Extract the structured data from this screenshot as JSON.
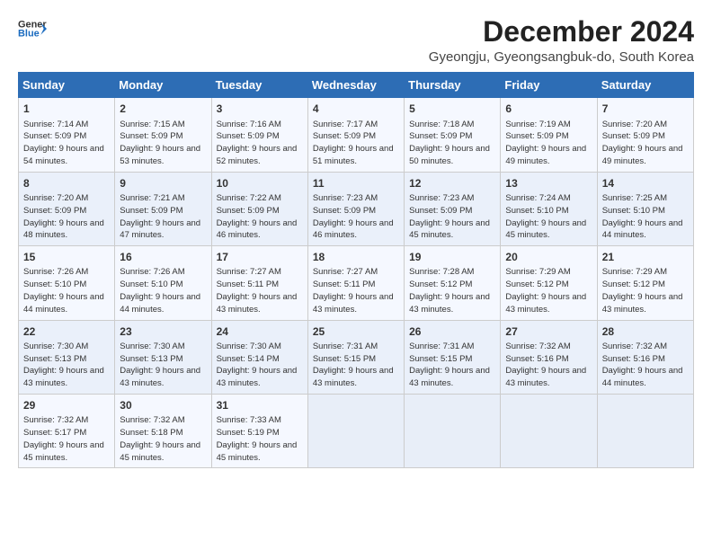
{
  "header": {
    "logo_line1": "General",
    "logo_line2": "Blue",
    "title": "December 2024",
    "subtitle": "Gyeongju, Gyeongsangbuk-do, South Korea"
  },
  "calendar": {
    "days_of_week": [
      "Sunday",
      "Monday",
      "Tuesday",
      "Wednesday",
      "Thursday",
      "Friday",
      "Saturday"
    ],
    "weeks": [
      [
        {
          "day": "",
          "empty": true
        },
        {
          "day": "",
          "empty": true
        },
        {
          "day": "",
          "empty": true
        },
        {
          "day": "",
          "empty": true
        },
        {
          "day": "5",
          "sunrise": "Sunrise: 7:18 AM",
          "sunset": "Sunset: 5:09 PM",
          "daylight": "Daylight: 9 hours and 50 minutes."
        },
        {
          "day": "6",
          "sunrise": "Sunrise: 7:19 AM",
          "sunset": "Sunset: 5:09 PM",
          "daylight": "Daylight: 9 hours and 49 minutes."
        },
        {
          "day": "7",
          "sunrise": "Sunrise: 7:20 AM",
          "sunset": "Sunset: 5:09 PM",
          "daylight": "Daylight: 9 hours and 49 minutes."
        }
      ],
      [
        {
          "day": "1",
          "sunrise": "Sunrise: 7:14 AM",
          "sunset": "Sunset: 5:09 PM",
          "daylight": "Daylight: 9 hours and 54 minutes."
        },
        {
          "day": "2",
          "sunrise": "Sunrise: 7:15 AM",
          "sunset": "Sunset: 5:09 PM",
          "daylight": "Daylight: 9 hours and 53 minutes."
        },
        {
          "day": "3",
          "sunrise": "Sunrise: 7:16 AM",
          "sunset": "Sunset: 5:09 PM",
          "daylight": "Daylight: 9 hours and 52 minutes."
        },
        {
          "day": "4",
          "sunrise": "Sunrise: 7:17 AM",
          "sunset": "Sunset: 5:09 PM",
          "daylight": "Daylight: 9 hours and 51 minutes."
        },
        {
          "day": "5",
          "sunrise": "Sunrise: 7:18 AM",
          "sunset": "Sunset: 5:09 PM",
          "daylight": "Daylight: 9 hours and 50 minutes."
        },
        {
          "day": "6",
          "sunrise": "Sunrise: 7:19 AM",
          "sunset": "Sunset: 5:09 PM",
          "daylight": "Daylight: 9 hours and 49 minutes."
        },
        {
          "day": "7",
          "sunrise": "Sunrise: 7:20 AM",
          "sunset": "Sunset: 5:09 PM",
          "daylight": "Daylight: 9 hours and 49 minutes."
        }
      ],
      [
        {
          "day": "8",
          "sunrise": "Sunrise: 7:20 AM",
          "sunset": "Sunset: 5:09 PM",
          "daylight": "Daylight: 9 hours and 48 minutes."
        },
        {
          "day": "9",
          "sunrise": "Sunrise: 7:21 AM",
          "sunset": "Sunset: 5:09 PM",
          "daylight": "Daylight: 9 hours and 47 minutes."
        },
        {
          "day": "10",
          "sunrise": "Sunrise: 7:22 AM",
          "sunset": "Sunset: 5:09 PM",
          "daylight": "Daylight: 9 hours and 46 minutes."
        },
        {
          "day": "11",
          "sunrise": "Sunrise: 7:23 AM",
          "sunset": "Sunset: 5:09 PM",
          "daylight": "Daylight: 9 hours and 46 minutes."
        },
        {
          "day": "12",
          "sunrise": "Sunrise: 7:23 AM",
          "sunset": "Sunset: 5:09 PM",
          "daylight": "Daylight: 9 hours and 45 minutes."
        },
        {
          "day": "13",
          "sunrise": "Sunrise: 7:24 AM",
          "sunset": "Sunset: 5:10 PM",
          "daylight": "Daylight: 9 hours and 45 minutes."
        },
        {
          "day": "14",
          "sunrise": "Sunrise: 7:25 AM",
          "sunset": "Sunset: 5:10 PM",
          "daylight": "Daylight: 9 hours and 44 minutes."
        }
      ],
      [
        {
          "day": "15",
          "sunrise": "Sunrise: 7:26 AM",
          "sunset": "Sunset: 5:10 PM",
          "daylight": "Daylight: 9 hours and 44 minutes."
        },
        {
          "day": "16",
          "sunrise": "Sunrise: 7:26 AM",
          "sunset": "Sunset: 5:10 PM",
          "daylight": "Daylight: 9 hours and 44 minutes."
        },
        {
          "day": "17",
          "sunrise": "Sunrise: 7:27 AM",
          "sunset": "Sunset: 5:11 PM",
          "daylight": "Daylight: 9 hours and 43 minutes."
        },
        {
          "day": "18",
          "sunrise": "Sunrise: 7:27 AM",
          "sunset": "Sunset: 5:11 PM",
          "daylight": "Daylight: 9 hours and 43 minutes."
        },
        {
          "day": "19",
          "sunrise": "Sunrise: 7:28 AM",
          "sunset": "Sunset: 5:12 PM",
          "daylight": "Daylight: 9 hours and 43 minutes."
        },
        {
          "day": "20",
          "sunrise": "Sunrise: 7:29 AM",
          "sunset": "Sunset: 5:12 PM",
          "daylight": "Daylight: 9 hours and 43 minutes."
        },
        {
          "day": "21",
          "sunrise": "Sunrise: 7:29 AM",
          "sunset": "Sunset: 5:12 PM",
          "daylight": "Daylight: 9 hours and 43 minutes."
        }
      ],
      [
        {
          "day": "22",
          "sunrise": "Sunrise: 7:30 AM",
          "sunset": "Sunset: 5:13 PM",
          "daylight": "Daylight: 9 hours and 43 minutes."
        },
        {
          "day": "23",
          "sunrise": "Sunrise: 7:30 AM",
          "sunset": "Sunset: 5:13 PM",
          "daylight": "Daylight: 9 hours and 43 minutes."
        },
        {
          "day": "24",
          "sunrise": "Sunrise: 7:30 AM",
          "sunset": "Sunset: 5:14 PM",
          "daylight": "Daylight: 9 hours and 43 minutes."
        },
        {
          "day": "25",
          "sunrise": "Sunrise: 7:31 AM",
          "sunset": "Sunset: 5:15 PM",
          "daylight": "Daylight: 9 hours and 43 minutes."
        },
        {
          "day": "26",
          "sunrise": "Sunrise: 7:31 AM",
          "sunset": "Sunset: 5:15 PM",
          "daylight": "Daylight: 9 hours and 43 minutes."
        },
        {
          "day": "27",
          "sunrise": "Sunrise: 7:32 AM",
          "sunset": "Sunset: 5:16 PM",
          "daylight": "Daylight: 9 hours and 43 minutes."
        },
        {
          "day": "28",
          "sunrise": "Sunrise: 7:32 AM",
          "sunset": "Sunset: 5:16 PM",
          "daylight": "Daylight: 9 hours and 44 minutes."
        }
      ],
      [
        {
          "day": "29",
          "sunrise": "Sunrise: 7:32 AM",
          "sunset": "Sunset: 5:17 PM",
          "daylight": "Daylight: 9 hours and 45 minutes."
        },
        {
          "day": "30",
          "sunrise": "Sunrise: 7:32 AM",
          "sunset": "Sunset: 5:18 PM",
          "daylight": "Daylight: 9 hours and 45 minutes."
        },
        {
          "day": "31",
          "sunrise": "Sunrise: 7:33 AM",
          "sunset": "Sunset: 5:19 PM",
          "daylight": "Daylight: 9 hours and 45 minutes."
        },
        {
          "day": "",
          "empty": true
        },
        {
          "day": "",
          "empty": true
        },
        {
          "day": "",
          "empty": true
        },
        {
          "day": "",
          "empty": true
        }
      ]
    ]
  }
}
